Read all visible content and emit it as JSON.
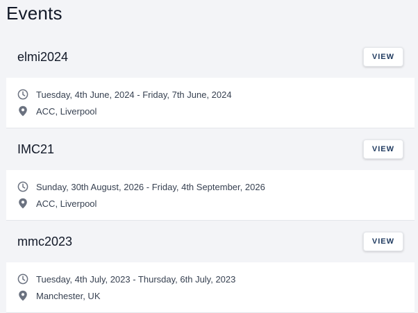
{
  "page": {
    "title": "Events"
  },
  "events": [
    {
      "name": "elmi2024",
      "view_label": "VIEW",
      "dates": "Tuesday, 4th June, 2024 - Friday, 7th June, 2024",
      "location": "ACC, Liverpool"
    },
    {
      "name": "IMC21",
      "view_label": "VIEW",
      "dates": "Sunday, 30th August, 2026 - Friday, 4th September, 2026",
      "location": "ACC, Liverpool"
    },
    {
      "name": "mmc2023",
      "view_label": "VIEW",
      "dates": "Tuesday, 4th July, 2023 - Thursday, 6th July, 2023",
      "location": "Manchester, UK"
    }
  ],
  "icons": {
    "date": "clock-icon",
    "location": "map-pin-icon"
  },
  "colors": {
    "background": "#f3f4f7",
    "card": "#ffffff",
    "button_text": "#1f3a5f",
    "icon": "#6b7280"
  }
}
